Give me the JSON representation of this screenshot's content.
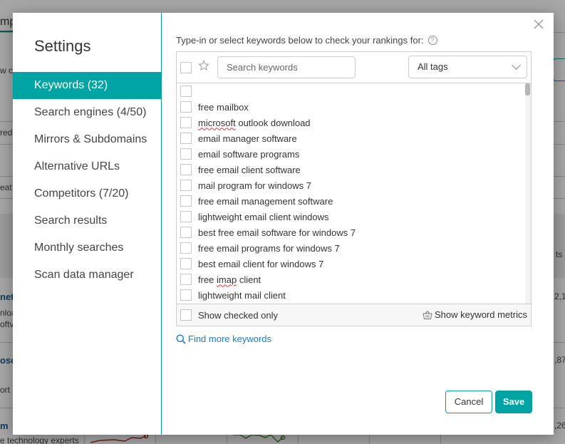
{
  "background": {
    "snippets": [
      "mp",
      "w c",
      "red",
      "eat",
      "net",
      "nloa",
      "oftv",
      "osc",
      "ort",
      "m",
      "e technology experts",
      "ts",
      "2,1",
      ",87",
      ",26"
    ]
  },
  "dialog": {
    "title": "Settings",
    "close_icon": "close-icon",
    "sidebar": {
      "items": [
        {
          "label": "Keywords (32)",
          "active": true
        },
        {
          "label": "Search engines (4/50)",
          "active": false
        },
        {
          "label": "Mirrors & Subdomains",
          "active": false
        },
        {
          "label": "Alternative URLs",
          "active": false
        },
        {
          "label": "Competitors (7/20)",
          "active": false
        },
        {
          "label": "Search results",
          "active": false
        },
        {
          "label": "Monthly searches",
          "active": false
        },
        {
          "label": "Scan data manager",
          "active": false
        }
      ]
    },
    "main": {
      "intro": "Type-in or select keywords below to check your rankings for:",
      "help_icon": "?",
      "search": {
        "placeholder": "Search keywords",
        "value": ""
      },
      "tags_select": {
        "selected": "All tags"
      },
      "keywords": [
        {
          "text": "",
          "checked": false,
          "spell": ""
        },
        {
          "text": "free mailbox",
          "checked": false,
          "spell": ""
        },
        {
          "text": "microsoft outlook download",
          "checked": false,
          "spell": "microsoft"
        },
        {
          "text": "email manager software",
          "checked": false,
          "spell": ""
        },
        {
          "text": "email software programs",
          "checked": false,
          "spell": ""
        },
        {
          "text": "free email client software",
          "checked": false,
          "spell": ""
        },
        {
          "text": "mail program for windows 7",
          "checked": false,
          "spell": ""
        },
        {
          "text": "free email management software",
          "checked": false,
          "spell": ""
        },
        {
          "text": "lightweight email client windows",
          "checked": false,
          "spell": ""
        },
        {
          "text": "best free email software for windows 7",
          "checked": false,
          "spell": ""
        },
        {
          "text": "free email programs for windows 7",
          "checked": false,
          "spell": ""
        },
        {
          "text": "best email client for windows 7",
          "checked": false,
          "spell": ""
        },
        {
          "text": "free imap client",
          "checked": false,
          "spell": "imap"
        },
        {
          "text": "lightweight mail client",
          "checked": false,
          "spell": ""
        }
      ],
      "show_checked_only": "Show checked only",
      "show_metrics": "Show keyword metrics",
      "find_more": "Find more keywords",
      "cancel_label": "Cancel",
      "save_label": "Save"
    }
  },
  "colors": {
    "accent": "#00a3a3",
    "link": "#1e7ac4"
  }
}
